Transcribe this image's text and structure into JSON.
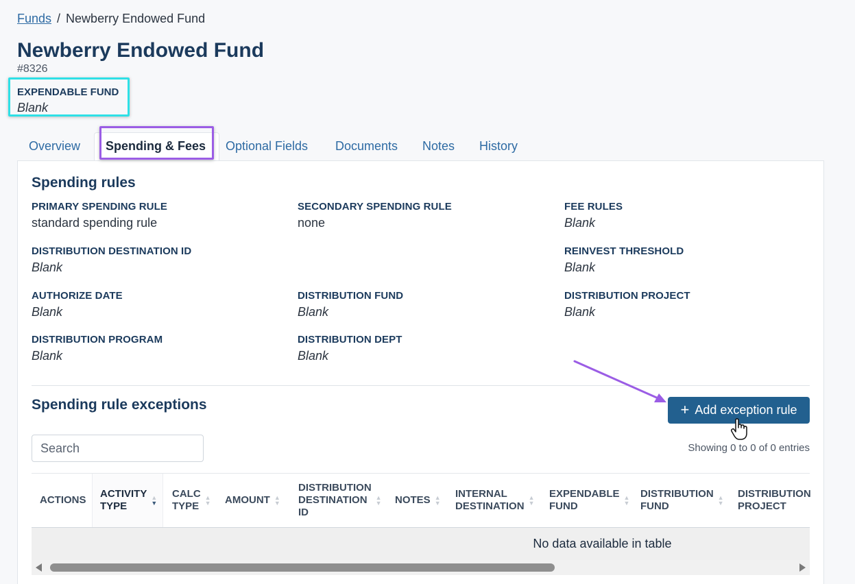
{
  "breadcrumb": {
    "root": "Funds",
    "separator": "/",
    "current": "Newberry Endowed Fund"
  },
  "fund": {
    "title": "Newberry Endowed Fund",
    "id": "#8326"
  },
  "expendable_fund": {
    "label": "EXPENDABLE FUND",
    "value": "Blank"
  },
  "tabs": [
    {
      "label": "Overview"
    },
    {
      "label": "Spending & Fees",
      "active": true
    },
    {
      "label": "Optional Fields"
    },
    {
      "label": "Documents"
    },
    {
      "label": "Notes"
    },
    {
      "label": "History"
    }
  ],
  "spending_rules": {
    "title": "Spending rules",
    "fields": {
      "primary_spending_rule": {
        "label": "PRIMARY SPENDING RULE",
        "value": "standard spending rule"
      },
      "secondary_spending_rule": {
        "label": "SECONDARY SPENDING RULE",
        "value": "none"
      },
      "fee_rules": {
        "label": "FEE RULES",
        "value": "Blank"
      },
      "distribution_destination_id": {
        "label": "DISTRIBUTION DESTINATION ID",
        "value": "Blank"
      },
      "reinvest_threshold": {
        "label": "REINVEST THRESHOLD",
        "value": "Blank"
      },
      "authorize_date": {
        "label": "AUTHORIZE DATE",
        "value": "Blank"
      },
      "distribution_fund": {
        "label": "DISTRIBUTION FUND",
        "value": "Blank"
      },
      "distribution_project": {
        "label": "DISTRIBUTION PROJECT",
        "value": "Blank"
      },
      "distribution_program": {
        "label": "DISTRIBUTION PROGRAM",
        "value": "Blank"
      },
      "distribution_dept": {
        "label": "DISTRIBUTION DEPT",
        "value": "Blank"
      }
    }
  },
  "exceptions": {
    "title": "Spending rule exceptions",
    "add_button": "Add exception rule",
    "search_placeholder": "Search",
    "showing": "Showing 0 to 0 of 0 entries",
    "columns": [
      {
        "line1": "ACTIONS",
        "line2": "",
        "line3": ""
      },
      {
        "line1": "ACTIVITY",
        "line2": "TYPE",
        "line3": ""
      },
      {
        "line1": "CALC",
        "line2": "TYPE",
        "line3": ""
      },
      {
        "line1": "AMOUNT",
        "line2": "",
        "line3": ""
      },
      {
        "line1": "DISTRIBUTION",
        "line2": "DESTINATION",
        "line3": "ID"
      },
      {
        "line1": "NOTES",
        "line2": "",
        "line3": ""
      },
      {
        "line1": "INTERNAL",
        "line2": "DESTINATION",
        "line3": ""
      },
      {
        "line1": "EXPENDABLE",
        "line2": "FUND",
        "line3": ""
      },
      {
        "line1": "DISTRIBUTION",
        "line2": "FUND",
        "line3": ""
      },
      {
        "line1": "DISTRIBUTION",
        "line2": "PROJECT",
        "line3": ""
      }
    ],
    "empty_message": "No data available in table"
  },
  "colors": {
    "primary_button": "#22608f",
    "title": "#1b3a5c",
    "link": "#2d6aa3",
    "highlight_cyan": "#2ee0e6",
    "highlight_purple": "#9b5de5"
  },
  "icons": [
    "plus-icon",
    "hand-cursor-icon",
    "sort-icon",
    "scroll-left-icon",
    "scroll-right-icon"
  ]
}
